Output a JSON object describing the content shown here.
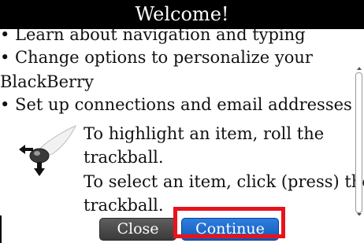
{
  "dialog": {
    "title": "Welcome!",
    "bullets": [
      "• Learn about navigation and typing",
      "• Change options to personalize your",
      "BlackBerry",
      "• Set up connections and email addresses"
    ],
    "tip_lines": [
      "To highlight an item, roll the",
      "trackball.",
      "To select an item, click (press) the",
      "trackball."
    ],
    "tip_icon": "trackball-hand-icon"
  },
  "buttons": {
    "close_label": "Close",
    "continue_label": "Continue"
  },
  "colors": {
    "highlight": "#e8131b",
    "continue_bg": "#1f6fd1",
    "close_bg": "#4a4a4a"
  }
}
